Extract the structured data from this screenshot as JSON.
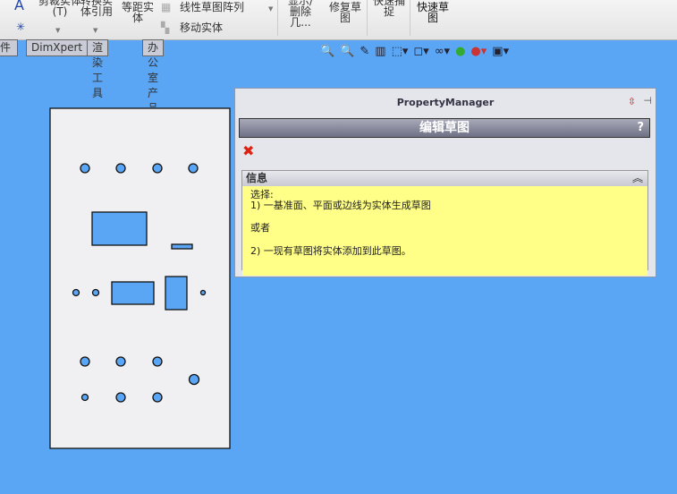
{
  "ribbon": {
    "items": [
      "剪裁实体(T)",
      "转换实体引用",
      "等距实体",
      "线性草图阵列",
      "移动实体",
      "显示/删除几...",
      "修复草图",
      "快速捕捉",
      "快速草图"
    ]
  },
  "tabs": [
    "件",
    "DimXpert",
    "渲染工具",
    "办公室产品"
  ],
  "view_toolbar": {
    "icons": [
      "zoom-to-fit-icon",
      "zoom-area-icon",
      "previous-view-icon",
      "section-view-icon",
      "view-orientation-icon",
      "display-style-icon",
      "hide-show-icon",
      "edit-appearance-icon",
      "apply-scene-icon",
      "view-settings-icon"
    ]
  },
  "property_manager": {
    "title": "PropertyManager",
    "heading": "编辑草图",
    "help": "?",
    "close": "✖",
    "info": {
      "title": "信息",
      "lines": [
        "选择:",
        "1) 一基准面、平面或边线为实体生成草图",
        "或者",
        "2) 一现有草图将实体添加到此草图。"
      ]
    }
  }
}
